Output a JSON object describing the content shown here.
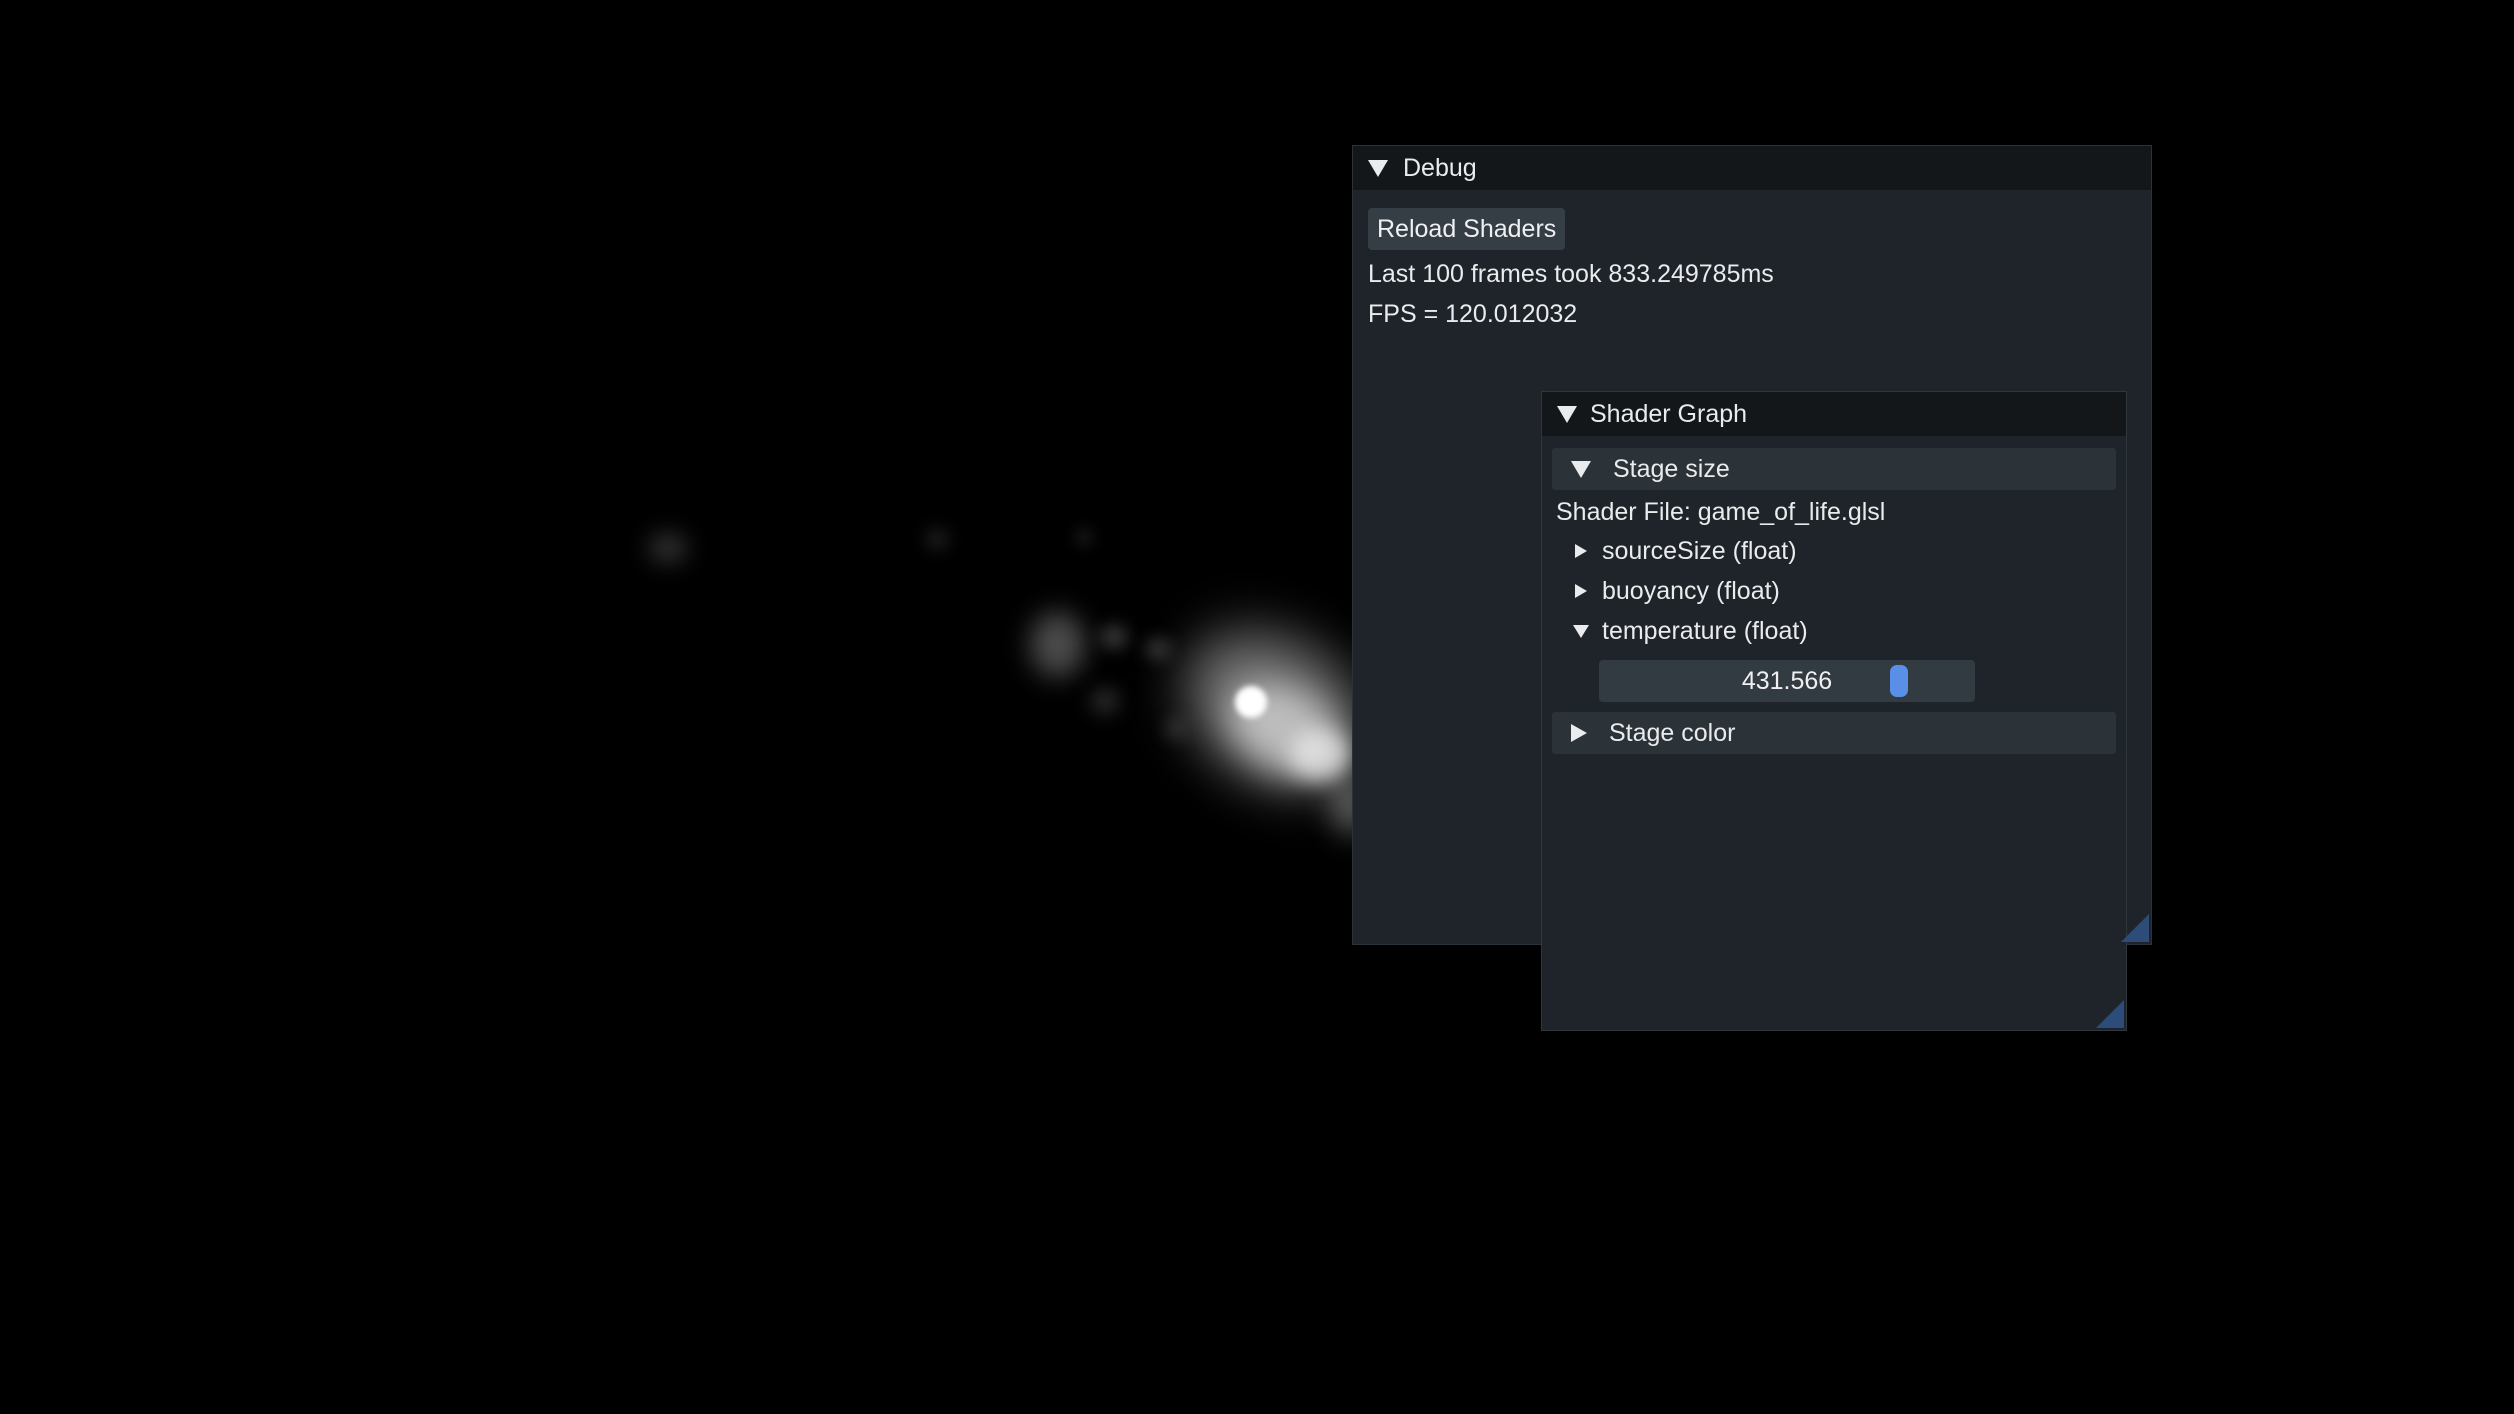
{
  "colors": {
    "background": "#000000",
    "window_bg": "#1e2429",
    "titlebar_bg": "#13171a",
    "header_bg": "#2b3238",
    "button_bg": "#363e45",
    "slider_grab": "#5a8fe8",
    "resize_grip": "#2e4c7a",
    "text": "#e9ebed"
  },
  "debug_window": {
    "title": "Debug",
    "title_icon": "collapse-arrow-down",
    "reload_button_label": "Reload Shaders",
    "frames_text": "Last 100 frames took 833.249785ms",
    "fps_text": "FPS = 120.012032"
  },
  "shader_graph": {
    "title": "Shader Graph",
    "title_icon": "collapse-arrow-down",
    "stage_size": {
      "label": "Stage size",
      "expanded": true,
      "shader_file": "Shader File: game_of_life.glsl",
      "params": [
        {
          "label": "sourceSize (float)",
          "expanded": false
        },
        {
          "label": "buoyancy (float)",
          "expanded": false
        },
        {
          "label": "temperature (float)",
          "expanded": true
        }
      ],
      "temperature_slider": {
        "value": "431.566",
        "position_fraction": 0.82
      }
    },
    "stage_color": {
      "label": "Stage color",
      "expanded": false
    }
  }
}
